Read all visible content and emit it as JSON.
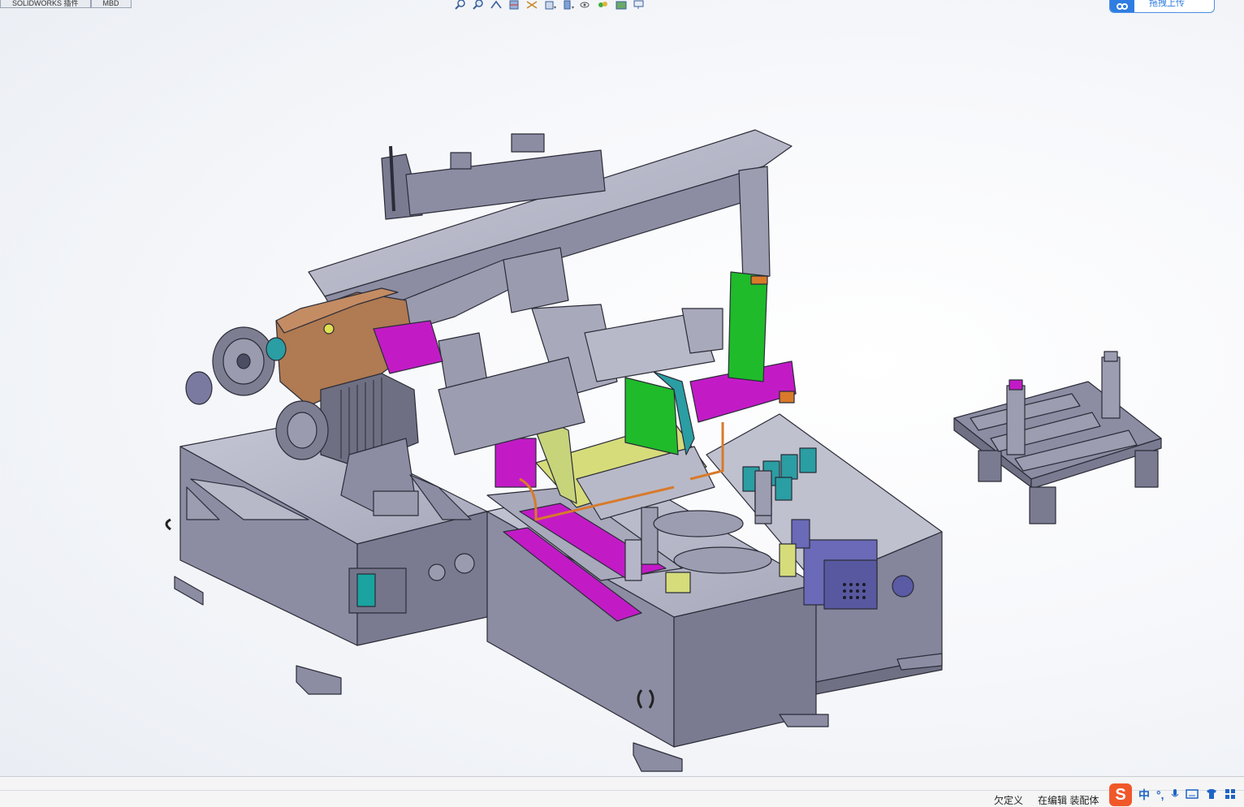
{
  "command_tabs": [
    "SOLIDWORKS 插件",
    "MBD"
  ],
  "view_toolbar": {
    "icons": [
      "zoom-to-fit-icon",
      "zoom-area-icon",
      "previous-view-icon",
      "section-view-icon",
      "dynamic-annotation-icon",
      "view-orientation-icon",
      "display-style-icon",
      "hide-show-items-icon",
      "edit-appearance-icon",
      "apply-scene-icon",
      "view-settings-icon"
    ]
  },
  "upload": {
    "label": "拖拽上传"
  },
  "status": {
    "definition": "欠定义",
    "mode": "在编辑 装配体"
  },
  "ime": {
    "logo": "S",
    "items": [
      "中",
      "°,",
      "mic-icon",
      "keyboard-icon",
      "shirt-icon",
      "grid-icon"
    ],
    "lang": "中"
  },
  "colors": {
    "machine_body": "#8e8fa6",
    "machine_dark": "#4b4d62",
    "motor_brown": "#b07a52",
    "magenta": "#c21bc6",
    "green": "#1fbb2a",
    "yellow_green": "#d6dc7a",
    "teal": "#2a9ea3",
    "orange_pipe": "#d87a2a",
    "blue_motor": "#6a6ab8"
  }
}
